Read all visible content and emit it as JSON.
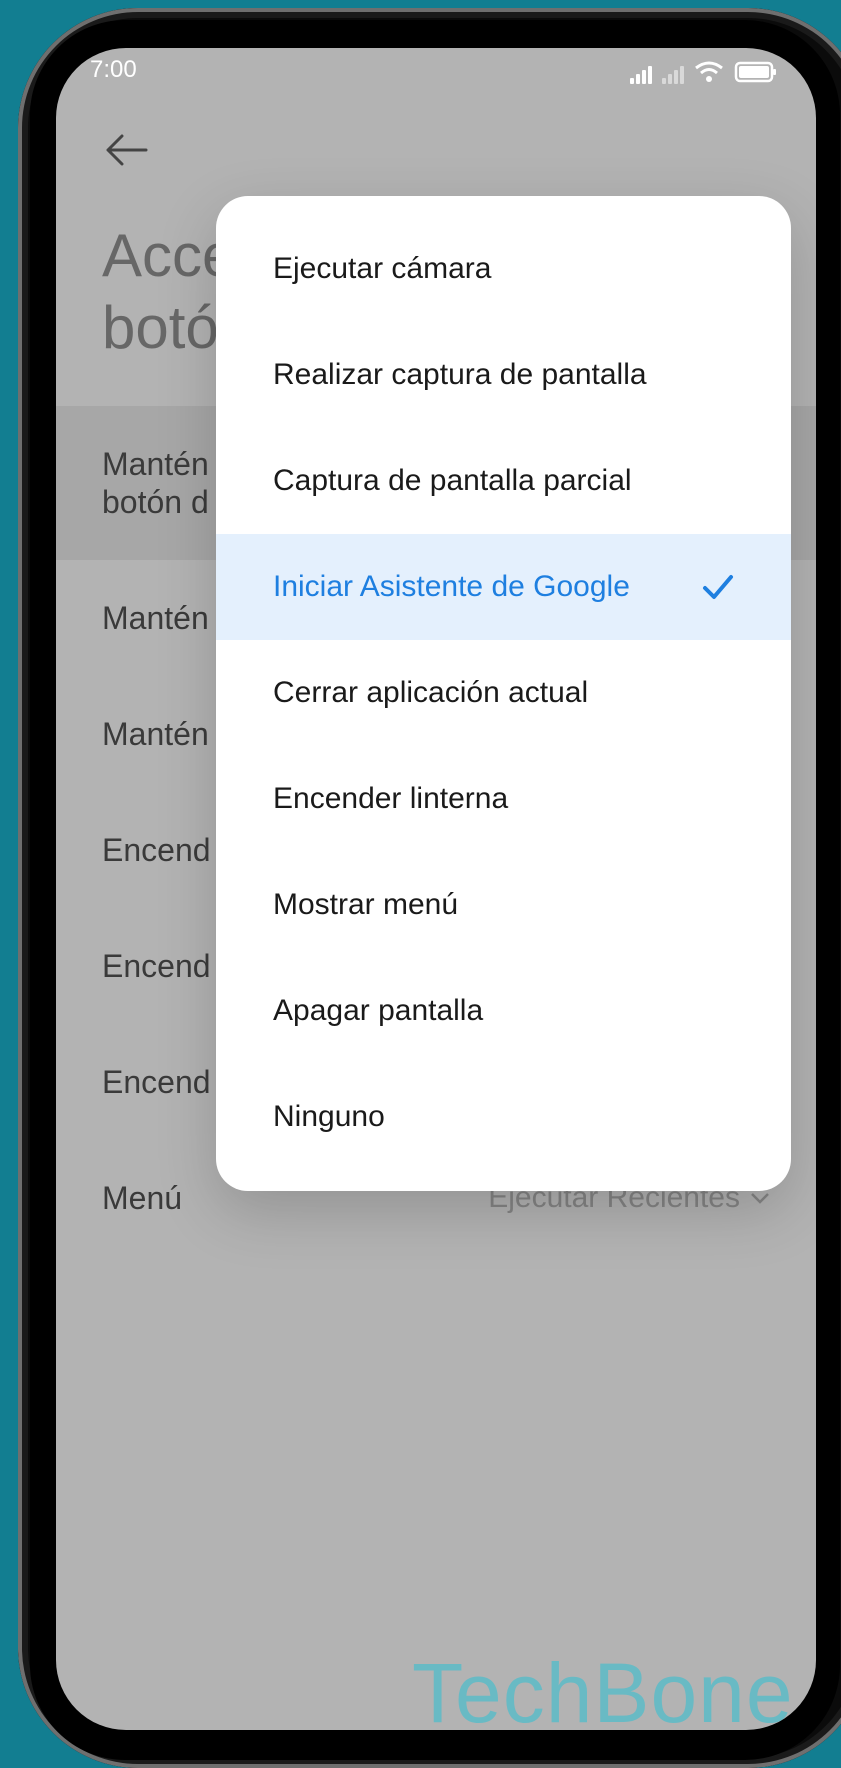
{
  "status_bar": {
    "time": "7:00"
  },
  "header": {
    "title": "Acceso rápido\nbotón"
  },
  "settings": [
    {
      "label": "Mantén\nbotón d",
      "highlight": true
    },
    {
      "label": "Mantén"
    },
    {
      "label": "Mantén"
    },
    {
      "label": "Encend"
    },
    {
      "label": "Encend"
    },
    {
      "label": "Encend"
    },
    {
      "label": "Menú",
      "value": "Ejecutar Recientes"
    }
  ],
  "dialog": {
    "options": [
      {
        "label": "Ejecutar cámara"
      },
      {
        "label": "Realizar captura de pantalla"
      },
      {
        "label": "Captura de pantalla parcial"
      },
      {
        "label": "Iniciar Asistente de Google",
        "selected": true
      },
      {
        "label": "Cerrar aplicación actual"
      },
      {
        "label": "Encender linterna"
      },
      {
        "label": "Mostrar menú"
      },
      {
        "label": "Apagar pantalla"
      },
      {
        "label": "Ninguno"
      }
    ]
  },
  "watermark": "TechBone",
  "colors": {
    "background": "#127e91",
    "accent": "#1e7fe0",
    "selected_bg": "#e4f0fd",
    "screen_dim": "#b3b3b3"
  },
  "icons": [
    "back-arrow-icon",
    "signal-icon",
    "wifi-icon",
    "battery-icon",
    "check-icon",
    "chevron-down-icon",
    "nav-back-icon",
    "nav-home-icon",
    "nav-recent-icon"
  ]
}
